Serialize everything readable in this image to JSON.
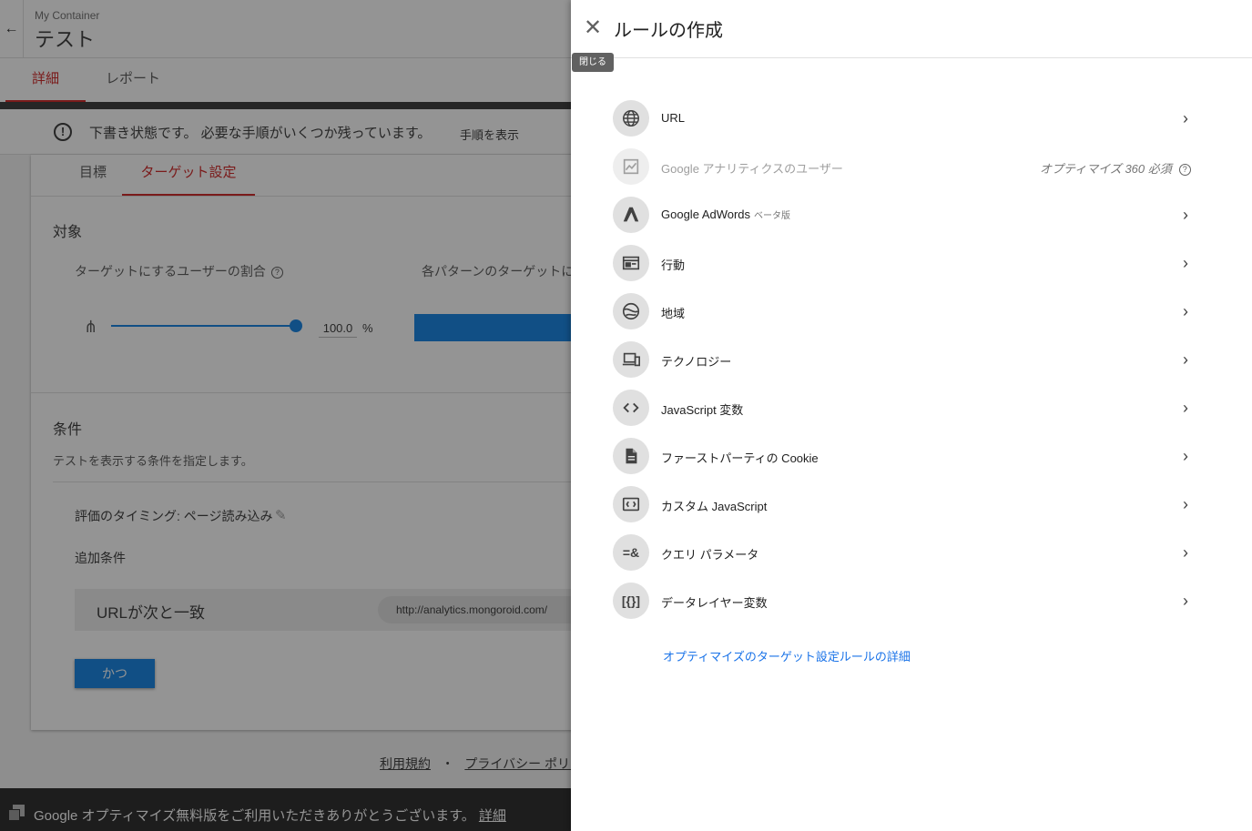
{
  "container": {
    "label": "My Container",
    "experiment_title": "テスト"
  },
  "main_tabs": [
    {
      "label": "詳細"
    },
    {
      "label": "レポート"
    }
  ],
  "draft_banner": {
    "message": "下書き状態です。 必要な手順がいくつか残っています。",
    "action": "手順を表示",
    "icon": "warning-circle-icon"
  },
  "sub_tabs": [
    {
      "label": "目標"
    },
    {
      "label": "ターゲット設定"
    }
  ],
  "targeting": {
    "section_title": "対象",
    "users_label": "ターゲットにするユーザーの割合",
    "variants_label": "各パターンのターゲットにす",
    "percent_value": "100.0",
    "percent_sign": "%",
    "slider_level": 1.0
  },
  "conditions": {
    "section_title": "条件",
    "description": "テストを表示する条件を指定します。",
    "timing": "評価のタイミング: ページ読み込み",
    "additional": "追加条件",
    "url_rule_label": "URLが次と一致",
    "url_value": "http://analytics.mongoroid.com/",
    "and_button": "かつ"
  },
  "footer": {
    "terms": "利用規約",
    "separator": "・",
    "privacy": "プライバシー ポリシー"
  },
  "bottom_bar": {
    "text": "Google オプティマイズ無料版をご利用いただきありがとうございます。",
    "link": "詳細"
  },
  "panel": {
    "title": "ルールの作成",
    "close_tooltip": "閉じる",
    "rules": [
      {
        "label": "URL",
        "icon": "globe-icon"
      },
      {
        "label": "Google アナリティクスのユーザー",
        "icon": "analytics-chart-icon",
        "requirement": "オプティマイズ 360 必須",
        "disabled": true
      },
      {
        "label": "Google AdWords",
        "badge": "ベータ版",
        "icon": "adwords-icon"
      },
      {
        "label": "行動",
        "icon": "browser-window-icon"
      },
      {
        "label": "地域",
        "icon": "region-globe-icon"
      },
      {
        "label": "テクノロジー",
        "icon": "devices-icon"
      },
      {
        "label": "JavaScript 変数",
        "icon": "code-brackets-icon"
      },
      {
        "label": "ファーストパーティの Cookie",
        "icon": "document-icon"
      },
      {
        "label": "カスタム JavaScript",
        "icon": "custom-code-icon"
      },
      {
        "label": "クエリ パラメータ",
        "icon": "query-param-icon",
        "icon_text": "=&"
      },
      {
        "label": "データレイヤー変数",
        "icon": "datalayer-icon",
        "icon_text": "[{}]"
      }
    ],
    "learn_more": "オプティマイズのターゲット設定ルールの詳細"
  },
  "colors": {
    "accent_red": "#d32f2f",
    "primary_blue": "#1e88e5",
    "link_blue": "#1a73e8"
  }
}
